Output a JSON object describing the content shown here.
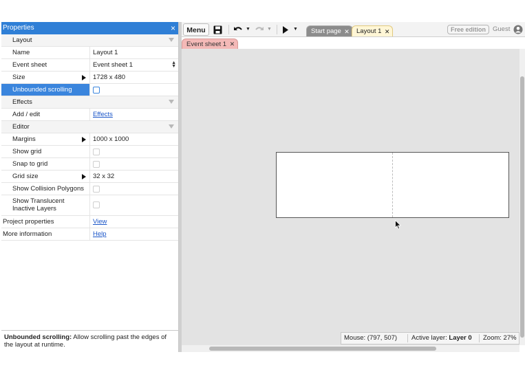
{
  "properties": {
    "title": "Properties",
    "close_glyph": "×",
    "sections": {
      "layout": "Layout",
      "effects": "Effects",
      "editor": "Editor"
    },
    "rows": {
      "name": {
        "label": "Name",
        "value": "Layout 1"
      },
      "event_sheet": {
        "label": "Event sheet",
        "value": "Event sheet 1"
      },
      "size": {
        "label": "Size",
        "value": "1728 x 480"
      },
      "unbounded_scrolling": {
        "label": "Unbounded scrolling",
        "checked": false
      },
      "add_edit": {
        "label": "Add / edit",
        "value": "Effects"
      },
      "margins": {
        "label": "Margins",
        "value": "1000 x 1000"
      },
      "show_grid": {
        "label": "Show grid",
        "checked": false
      },
      "snap_to_grid": {
        "label": "Snap to grid",
        "checked": false
      },
      "grid_size": {
        "label": "Grid size",
        "value": "32 x 32"
      },
      "show_collision_polygons": {
        "label": "Show Collision Polygons",
        "checked": false
      },
      "show_translucent_line1": "Show Translucent",
      "show_translucent_line2": "Inactive Layers",
      "project_properties": {
        "label": "Project properties",
        "value": "View"
      },
      "more_information": {
        "label": "More information",
        "value": "Help"
      }
    },
    "help": {
      "bold": "Unbounded scrolling:",
      "text": " Allow scrolling past the edges of the layout at runtime."
    }
  },
  "toolbar": {
    "menu_label": "Menu",
    "icons": [
      "save-icon",
      "undo-icon",
      "redo-icon",
      "play-icon",
      "user-icon"
    ],
    "tabs": [
      {
        "label": "Start page",
        "active": false
      },
      {
        "label": "Layout 1",
        "active": true
      }
    ],
    "free_edition": "Free edition",
    "guest": "Guest"
  },
  "subtabs": [
    {
      "label": "Event sheet 1"
    }
  ],
  "statusbar": {
    "mouse": "Mouse: (797, 507)",
    "active_layer_prefix": "Active layer: ",
    "active_layer_value": "Layer 0",
    "zoom": "Zoom: 27%"
  },
  "colors": {
    "accent": "#2f7fd6",
    "start_tab": "#8c8c8c",
    "layout_tab": "#fff6d6",
    "event_tab": "#f4b9b7",
    "workspace": "#e3e3e3"
  }
}
